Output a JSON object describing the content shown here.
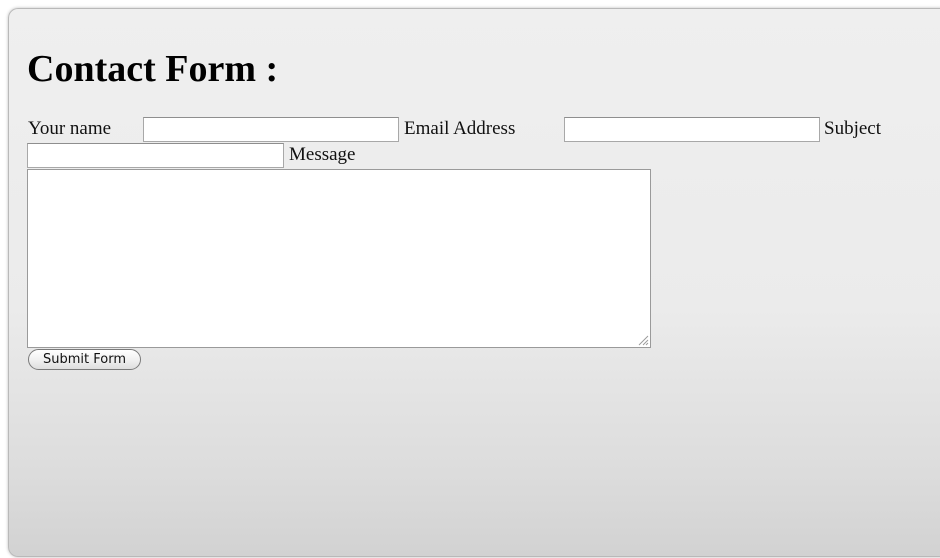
{
  "form": {
    "title": "Contact Form :",
    "fields": {
      "name": {
        "label": "Your name",
        "value": "",
        "placeholder": ""
      },
      "email": {
        "label": "Email Address",
        "value": "",
        "placeholder": ""
      },
      "subject": {
        "label": "Subject",
        "value": "",
        "placeholder": ""
      },
      "message": {
        "label": "Message",
        "value": "",
        "placeholder": ""
      }
    },
    "submit_label": "Submit Form"
  },
  "colors": {
    "panel_top": "#efefef",
    "panel_bottom": "#d2d2d2",
    "text": "#000000",
    "input_border": "#a8a8a8"
  },
  "icons": {
    "resize_grip": "resize-grip-icon"
  }
}
